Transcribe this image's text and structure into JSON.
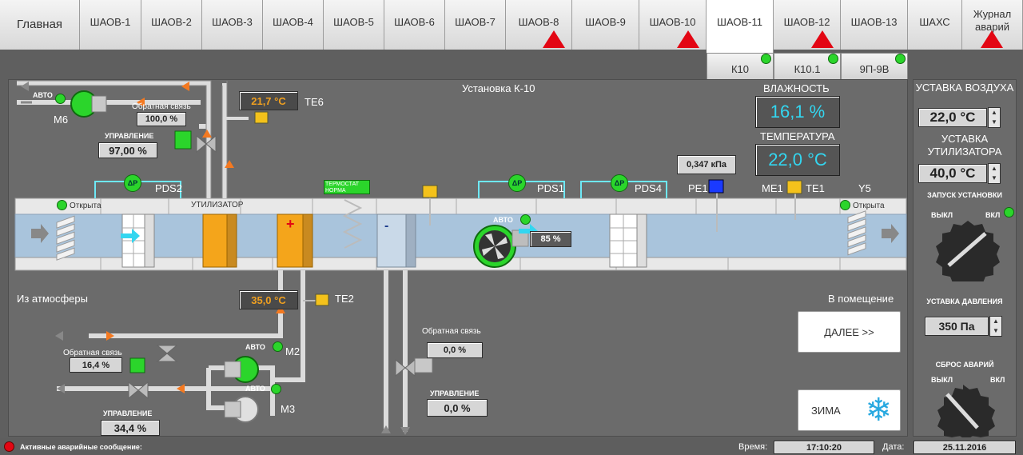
{
  "tabs": [
    {
      "label": "Главная"
    },
    {
      "label": "ШАОВ-1"
    },
    {
      "label": "ШАОВ-2"
    },
    {
      "label": "ШАОВ-3"
    },
    {
      "label": "ШАОВ-4"
    },
    {
      "label": "ШАОВ-5"
    },
    {
      "label": "ШАОВ-6"
    },
    {
      "label": "ШАОВ-7"
    },
    {
      "label": "ШАОВ-8"
    },
    {
      "label": "ШАОВ-9"
    },
    {
      "label": "ШАОВ-10"
    },
    {
      "label": "ШАОВ-11"
    },
    {
      "label": "ШАОВ-12"
    },
    {
      "label": "ШАОВ-13"
    },
    {
      "label": "ШАХС"
    },
    {
      "label": "Журнал аварий"
    }
  ],
  "subtabs": [
    {
      "label": "К10"
    },
    {
      "label": "К10.1"
    },
    {
      "label": "9П-9В"
    }
  ],
  "colors": {
    "accent": "#33d6f0",
    "alarm": "#e30613",
    "ok": "#2bd52b",
    "warm": "#f0a020"
  },
  "scheme": {
    "title": "Установка К-10",
    "humidity_label": "ВЛАЖНОСТЬ",
    "humidity_value": "16,1 %",
    "temperature_label": "ТЕМПЕРАТУРА",
    "temperature_value": "22,0 °C",
    "pressure_value": "0,347 кПа",
    "te6_value": "21,7 °C",
    "te6_label": "TE6",
    "te2_value": "35,0 °C",
    "te2_label": "TE2",
    "m6_label": "M6",
    "m2_label": "M2",
    "m3_label": "M3",
    "auto": "АВТО",
    "feedback_label": "Обратная связь",
    "control_label": "УПРАВЛЕНИЕ",
    "util_feedback": "100,0 %",
    "util_control": "97,00 %",
    "heat_feedback": "16,4 %",
    "heat_control": "34,4 %",
    "cool_feedback": "0,0 %",
    "cool_control": "0,0 %",
    "fan_value": "85 %",
    "pds2": "PDS2",
    "pds1": "PDS1",
    "pds4": "PDS4",
    "pe1": "PE1",
    "me1": "ME1",
    "te1": "TE1",
    "y5": "Y5",
    "dp": "ΔP",
    "util_label": "УТИЛИЗАТОР",
    "thermostat": "ТЕРМОСТАТ НОРМА",
    "open_left": "Открыта",
    "open_right": "Открыта",
    "from_atm": "Из атмосферы",
    "to_room": "В помещение",
    "next_button": "ДАЛЕЕ >>",
    "winter_button": "ЗИМА"
  },
  "side": {
    "air_setpoint_label": "УСТАВКА ВОЗДУХА",
    "air_setpoint_value": "22,0 °C",
    "util_setpoint_label": "УСТАВКА УТИЛИЗАТОРА",
    "util_setpoint_value": "40,0 °C",
    "start_label": "ЗАПУСК УСТАНОВКИ",
    "off": "ВЫКЛ",
    "on": "ВКЛ",
    "pressure_setpoint_label": "УСТАВКА ДАВЛЕНИЯ",
    "pressure_setpoint_value": "350 Па",
    "reset_label": "СБРОС АВАРИЙ"
  },
  "status": {
    "alarm_text": "Активные аварийные сообщение:",
    "time_label": "Время:",
    "time_value": "17:10:20",
    "date_label": "Дата:",
    "date_value": "25.11.2016"
  }
}
